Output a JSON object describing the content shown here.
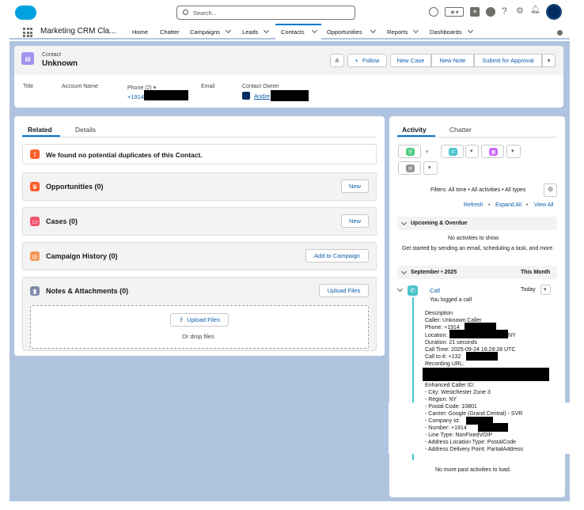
{
  "header": {
    "search_placeholder": "Search...",
    "icons": [
      "salesforce-logo",
      "favorites-star",
      "add",
      "setup-trailhead",
      "help",
      "gear",
      "bell",
      "avatar"
    ]
  },
  "nav": {
    "app_name": "Marketing CRM Cla...",
    "items": [
      {
        "label": "Home"
      },
      {
        "label": "Chatter"
      },
      {
        "label": "Campaigns"
      },
      {
        "label": "Leads"
      },
      {
        "label": "Contacts"
      },
      {
        "label": "Opportunities"
      },
      {
        "label": "Reports"
      },
      {
        "label": "Dashboards"
      }
    ]
  },
  "record": {
    "object_label": "Contact",
    "name": "Unknown",
    "follow_label": "Follow",
    "buttons": [
      "New Case",
      "New Note",
      "Submit for Approval"
    ],
    "fields": {
      "title_label": "Title",
      "account_label": "Account Name",
      "phone_label": "Phone (2)",
      "phone_value": "+1914",
      "email_label": "Email",
      "owner_label": "Contact Owner",
      "owner_value": "Andre"
    }
  },
  "left": {
    "tabs": [
      "Related",
      "Details"
    ],
    "duplicates_text": "We found no potential duplicates of this Contact.",
    "cards": [
      {
        "title": "Opportunities (0)",
        "button": "New",
        "color": "#ff5d2d"
      },
      {
        "title": "Cases (0)",
        "button": "New",
        "color": "#f2536b"
      },
      {
        "title": "Campaign History (0)",
        "button": "Add to Campaign",
        "color": "#f49756"
      },
      {
        "title": "Notes & Attachments (0)",
        "button": "Upload Files",
        "color": "#7f8ca8"
      }
    ],
    "upload_button": "Upload Files",
    "drop_text": "Or drop files"
  },
  "right": {
    "tabs": [
      "Activity",
      "Chatter"
    ],
    "filters_text": "Filters: All time • All activities • All types",
    "refresh": "Refresh",
    "expand_all": "Expand All",
    "view_all": "View All",
    "upcoming_label": "Upcoming & Overdue",
    "no_activities": "No activities to show.",
    "get_started": "Get started by sending an email, scheduling a task, and more.",
    "month_label": "September • 2025",
    "this_month": "This Month",
    "call_title": "Call",
    "call_date": "Today",
    "call_sub": "You logged a call",
    "desc_lines": [
      "Description",
      "Caller: Unknown Caller",
      "Phone: +1914",
      "Location:",
      "Duration: 21 seconds",
      "Call Time: 2025-09-24 16:28:28 UTC",
      "Call to #: +132",
      "Recording URL:",
      "",
      "Enhanced Caller ID:",
      "- City: Westchester Zone 3",
      "- Region: NY",
      "- Postal Code: 10801",
      "- Carrier: Google (Grand Central) - SVR",
      "- Company Id:",
      "- Number: +1914",
      "- Line Type: NonFixedVOIP",
      "- Address Location Type: PostalCode",
      "- Address Delivery Point: PartialAddress"
    ],
    "location_suffix": "NY",
    "no_more": "No more past activities to load."
  },
  "colors": {
    "page_bg": "#b0c4df",
    "brand": "#0176d3",
    "contact_icon": "#a094ed",
    "green": "#4bca81",
    "teal": "#48c3cc",
    "purple": "#cb65ff",
    "gray": "#939393"
  }
}
